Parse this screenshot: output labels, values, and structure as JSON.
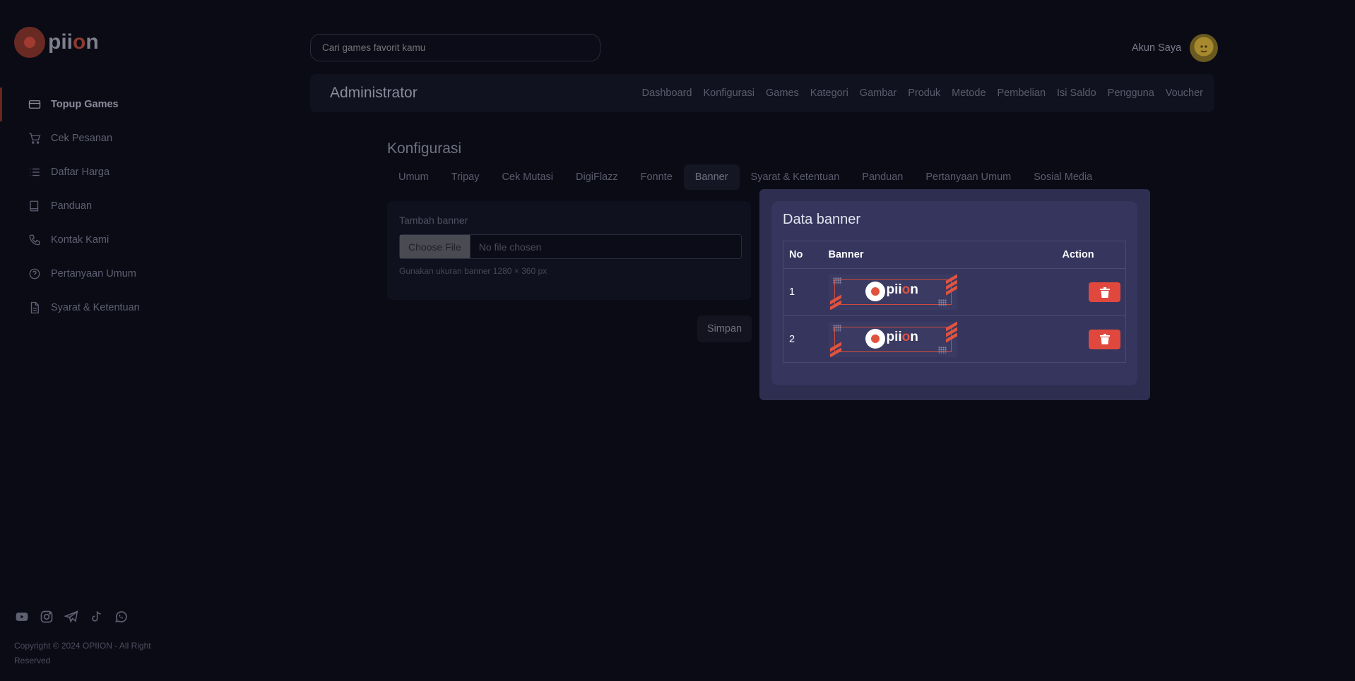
{
  "brand": {
    "logo_text_pre": "pii",
    "logo_text_o": "o",
    "logo_text_post": "n"
  },
  "search": {
    "placeholder": "Cari games favorit kamu"
  },
  "account": {
    "label": "Akun Saya"
  },
  "sidebar": {
    "items": [
      {
        "label": "Topup Games",
        "icon": "credit-card-icon",
        "active": true
      },
      {
        "label": "Cek Pesanan",
        "icon": "cart-icon",
        "active": false
      },
      {
        "label": "Daftar Harga",
        "icon": "list-icon",
        "active": false
      },
      {
        "label": "Panduan",
        "icon": "book-icon",
        "active": false
      },
      {
        "label": "Kontak Kami",
        "icon": "phone-icon",
        "active": false
      },
      {
        "label": "Pertanyaan Umum",
        "icon": "question-icon",
        "active": false
      },
      {
        "label": "Syarat & Ketentuan",
        "icon": "document-icon",
        "active": false
      }
    ],
    "socials": [
      "youtube-icon",
      "instagram-icon",
      "telegram-icon",
      "tiktok-icon",
      "whatsapp-icon"
    ],
    "copyright": "Copyright © 2024 OPIION - All Right Reserved"
  },
  "admin": {
    "title": "Administrator",
    "menu": [
      "Dashboard",
      "Konfigurasi",
      "Games",
      "Kategori",
      "Gambar",
      "Produk",
      "Metode",
      "Pembelian",
      "Isi Saldo",
      "Pengguna",
      "Voucher"
    ]
  },
  "config": {
    "title": "Konfigurasi",
    "tabs": [
      "Umum",
      "Tripay",
      "Cek Mutasi",
      "DigiFlazz",
      "Fonnte",
      "Banner",
      "Syarat & Ketentuan",
      "Panduan",
      "Pertanyaan Umum",
      "Sosial Media"
    ],
    "active_tab": "Banner",
    "upload": {
      "label": "Tambah banner",
      "button": "Choose File",
      "file_name": "No file chosen",
      "hint": "Gunakan ukuran banner 1280 × 360 px"
    },
    "save_label": "Simpan"
  },
  "modal": {
    "title": "Data banner",
    "headers": {
      "no": "No",
      "banner": "Banner",
      "action": "Action"
    },
    "rows": [
      {
        "no": "1",
        "banner_text_pre": "pii",
        "banner_text_o": "o",
        "banner_text_post": "n"
      },
      {
        "no": "2",
        "banner_text_pre": "pii",
        "banner_text_o": "o",
        "banner_text_post": "n"
      }
    ]
  },
  "colors": {
    "accent": "#e0483e",
    "modal_bg": "#35355e",
    "page_bg": "#0b0b16"
  }
}
